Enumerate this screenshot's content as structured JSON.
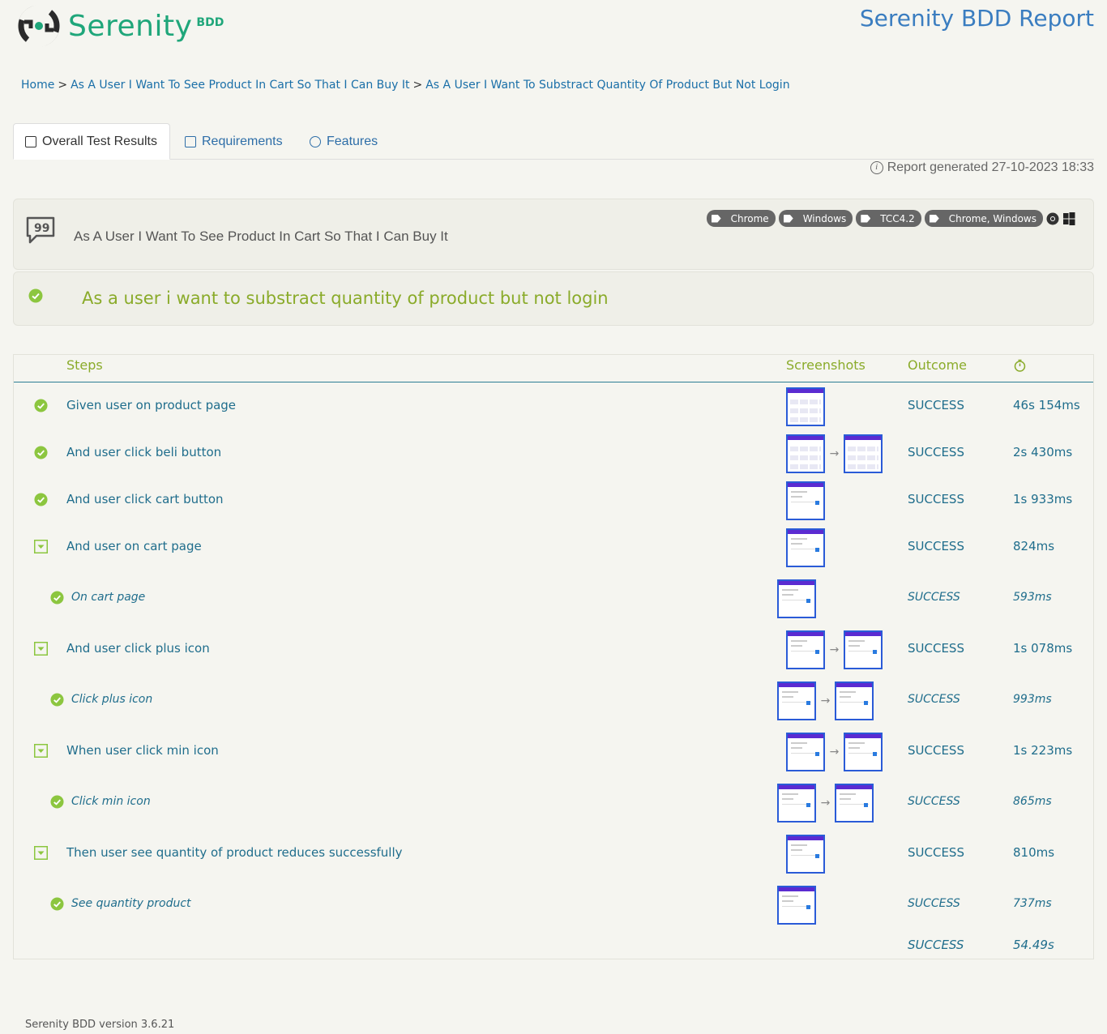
{
  "header": {
    "logo_text_main": "Serenity",
    "logo_text_sub": "BDD",
    "report_title": "Serenity BDD Report"
  },
  "breadcrumb": {
    "items": [
      "Home",
      "As A User I Want To See Product In Cart So That I Can Buy It",
      "As A User I Want To Substract Quantity Of Product But Not Login"
    ],
    "separator": ">"
  },
  "tabs": [
    {
      "label": "Overall Test Results",
      "active": true,
      "icon": "checklist-icon"
    },
    {
      "label": "Requirements",
      "active": false,
      "icon": "list-icon"
    },
    {
      "label": "Features",
      "active": false,
      "icon": "comment-icon"
    }
  ],
  "report_generated": "Report generated 27-10-2023 18:33",
  "requirement": {
    "title": "As A User I Want To See Product In Cart So That I Can Buy It",
    "tags": [
      "Chrome",
      "Windows",
      "TCC4.2",
      "Chrome, Windows"
    ]
  },
  "scenario": {
    "title": "As a user i want to substract quantity of product but not login"
  },
  "steps_table": {
    "headers": {
      "steps": "Steps",
      "screenshots": "Screenshots",
      "outcome": "Outcome"
    },
    "rows": [
      {
        "text": "Given user on product page",
        "outcome": "SUCCESS",
        "duration": "46s 154ms"
      },
      {
        "text": "And user click beli button",
        "outcome": "SUCCESS",
        "duration": "2s 430ms"
      },
      {
        "text": "And user click cart button",
        "outcome": "SUCCESS",
        "duration": "1s 933ms"
      },
      {
        "text": "And user on cart page",
        "outcome": "SUCCESS",
        "duration": "824ms"
      },
      {
        "text": "On cart page",
        "outcome": "SUCCESS",
        "duration": "593ms"
      },
      {
        "text": "And user click plus icon",
        "outcome": "SUCCESS",
        "duration": "1s 078ms"
      },
      {
        "text": "Click plus icon",
        "outcome": "SUCCESS",
        "duration": "993ms"
      },
      {
        "text": "When user click min icon",
        "outcome": "SUCCESS",
        "duration": "1s 223ms"
      },
      {
        "text": "Click min icon",
        "outcome": "SUCCESS",
        "duration": "865ms"
      },
      {
        "text": "Then user see quantity of product reduces successfully",
        "outcome": "SUCCESS",
        "duration": "810ms"
      },
      {
        "text": "See quantity product",
        "outcome": "SUCCESS",
        "duration": "737ms"
      }
    ],
    "total": {
      "outcome": "SUCCESS",
      "duration": "54.49s"
    }
  },
  "footer": {
    "version": "Serenity BDD version 3.6.21"
  },
  "colors": {
    "accent_green": "#8aab2a",
    "link_blue": "#1f6d8c",
    "title_blue": "#3a7dc0",
    "success_icon": "#8cc63f"
  }
}
